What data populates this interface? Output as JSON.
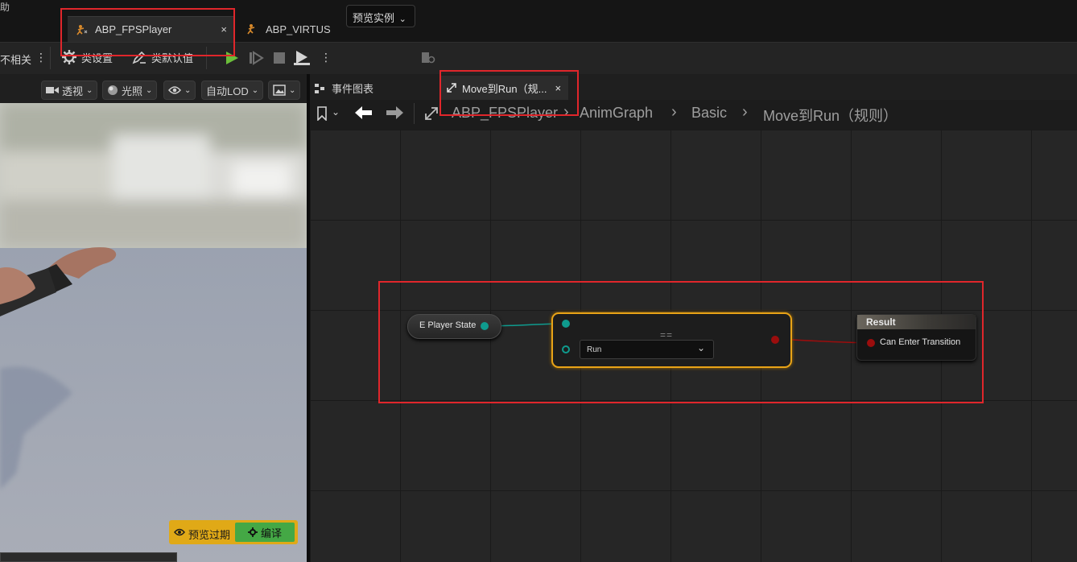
{
  "app": {
    "menu_fragment": "助"
  },
  "tabs": [
    {
      "label": "ABP_FPSPlayer",
      "close": "×",
      "active": true
    },
    {
      "label": "ABP_VIRTUS",
      "active": false
    }
  ],
  "toolbar": {
    "hide_unrelated": "不相关",
    "class_settings": "类设置",
    "class_defaults": "类默认值",
    "preview_instance": "预览实例"
  },
  "viewport": {
    "perspective": "透视",
    "lighting": "光照",
    "lod": "自动LOD",
    "stale_label": "预览过期",
    "compile": "编译"
  },
  "graph": {
    "event_graph_tab": "事件图表",
    "rule_tab": "Move到Run（规...",
    "rule_tab_close": "×",
    "breadcrumbs": [
      "ABP_FPSPlayer",
      "AnimGraph",
      "Basic",
      "Move到Run（规则）"
    ]
  },
  "nodes": {
    "player_state": {
      "label": "E Player State"
    },
    "equals": {
      "symbol": "==",
      "enum_value": "Run"
    },
    "result": {
      "title": "Result",
      "pin": "Can Enter Transition"
    }
  },
  "colors": {
    "accent_highlight": "#e0262b",
    "node_selected": "#e8a317",
    "enum_pin": "#0f9b8e",
    "bool_pin": "#9b0d0d",
    "compile_green": "#44a845",
    "stale_yellow": "#e0a917",
    "play_green": "#6bbf3a"
  }
}
